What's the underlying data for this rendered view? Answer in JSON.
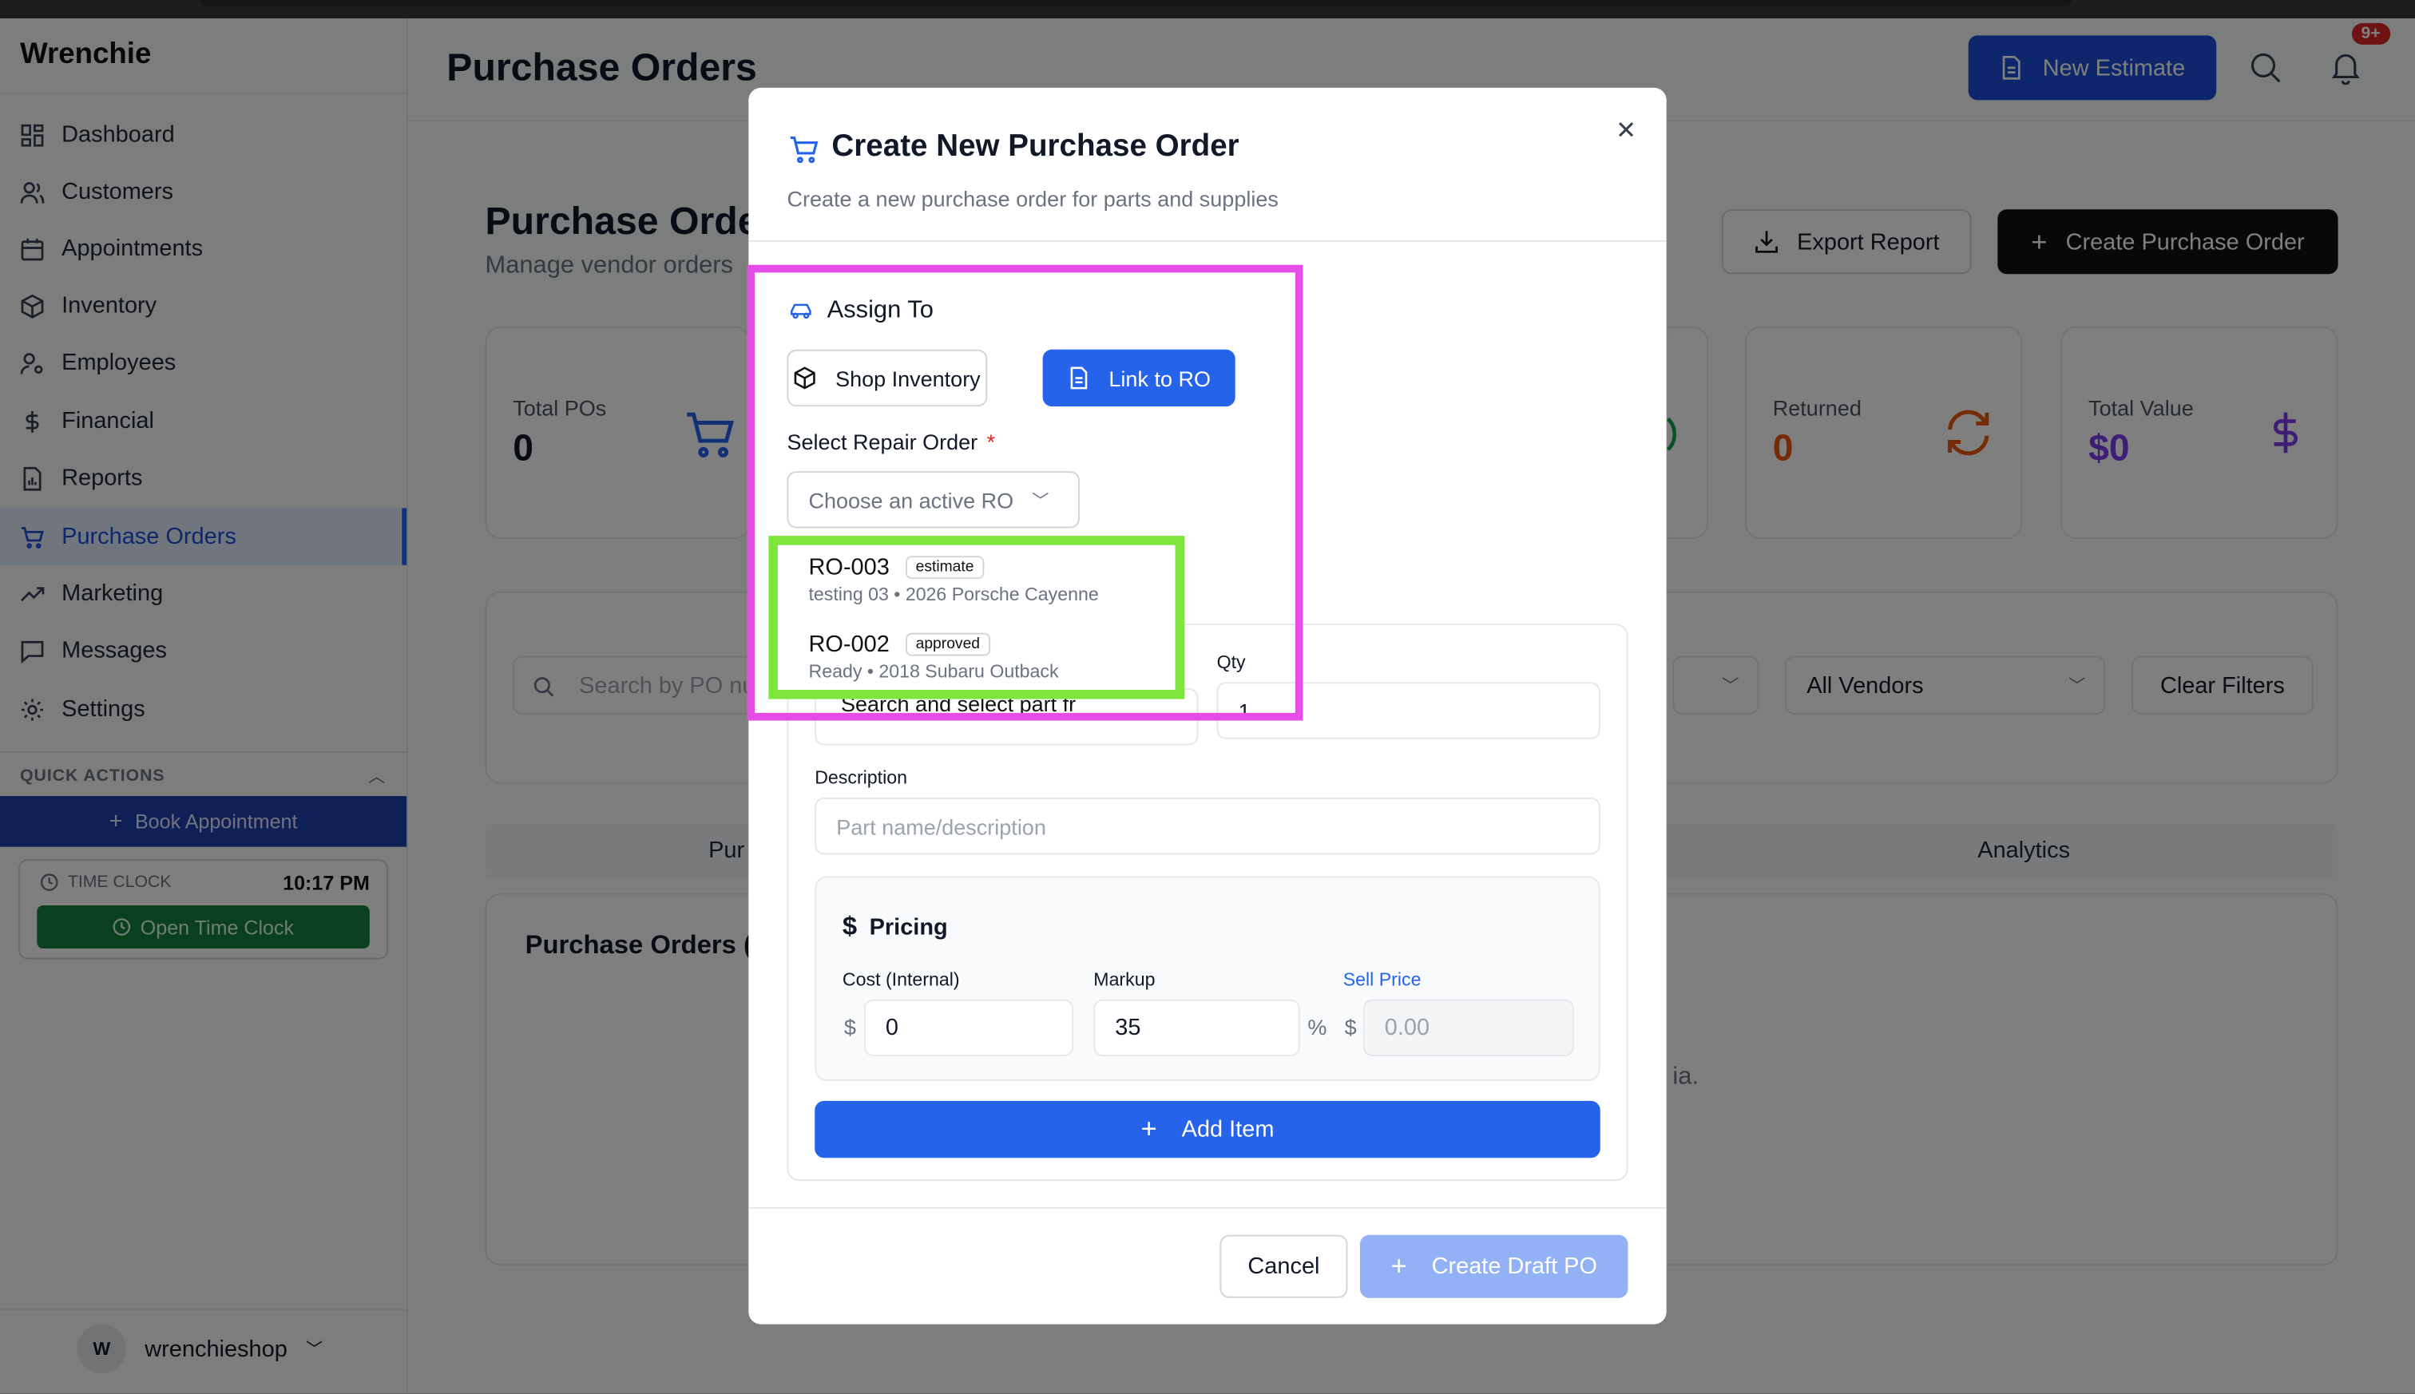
{
  "app": {
    "brand": "Wrenchie",
    "page_title": "Purchase Orders"
  },
  "sidebar": {
    "items": [
      {
        "label": "Dashboard",
        "icon": "grid-icon"
      },
      {
        "label": "Customers",
        "icon": "users-icon"
      },
      {
        "label": "Appointments",
        "icon": "calendar-icon"
      },
      {
        "label": "Inventory",
        "icon": "box-icon"
      },
      {
        "label": "Employees",
        "icon": "user-cog-icon"
      },
      {
        "label": "Financial",
        "icon": "dollar-icon"
      },
      {
        "label": "Reports",
        "icon": "report-icon"
      },
      {
        "label": "Purchase Orders",
        "icon": "cart-icon",
        "active": true
      },
      {
        "label": "Marketing",
        "icon": "trend-icon"
      },
      {
        "label": "Messages",
        "icon": "message-icon"
      },
      {
        "label": "Settings",
        "icon": "gear-icon"
      }
    ],
    "quick_actions": "QUICK ACTIONS",
    "book": "Book Appointment",
    "time_clock": {
      "label": "TIME CLOCK",
      "time": "10:17 PM",
      "button": "Open Time Clock"
    },
    "user": {
      "initial": "W",
      "name": "wrenchieshop"
    }
  },
  "header": {
    "new_estimate": "New Estimate",
    "notif_count": "9+"
  },
  "page": {
    "title": "Purchase Orders",
    "subtitle": "Manage vendor orders",
    "export": "Export Report",
    "create_po": "Create Purchase Order",
    "stats": [
      {
        "label": "Total POs",
        "value": "0"
      },
      {
        "label": "Returned",
        "value": "0"
      },
      {
        "label": "Total Value",
        "value": "$0"
      }
    ],
    "search_placeholder": "Search by PO nu",
    "vendor_filter": "All Vendors",
    "clear_filters": "Clear Filters",
    "tabs": {
      "first": "Pur",
      "analytics": "Analytics"
    },
    "po_card_title": "Purchase Orders (",
    "po_empty": "ia."
  },
  "modal": {
    "title": "Create New Purchase Order",
    "subtitle": "Create a new purchase order for parts and supplies",
    "assign_to": "Assign To",
    "shop_inventory": "Shop Inventory",
    "link_ro": "Link to RO",
    "select_ro_label": "Select Repair Order",
    "required": "*",
    "select_placeholder": "Choose an active RO",
    "ro_options": [
      {
        "id": "RO-003",
        "status": "estimate",
        "detail": "testing 03 • 2026 Porsche Cayenne"
      },
      {
        "id": "RO-002",
        "status": "approved",
        "detail": "Ready • 2018 Subaru Outback"
      }
    ],
    "qty_label": "Qty",
    "qty_value": "1",
    "part_placeholder": "Search and select part fr",
    "description_label": "Description",
    "description_placeholder": "Part name/description",
    "pricing": {
      "title": "Pricing",
      "cost_label": "Cost (Internal)",
      "markup_label": "Markup",
      "sell_label": "Sell Price",
      "currency": "$",
      "percent": "%",
      "cost_value": "0",
      "markup_value": "35",
      "sell_placeholder": "0.00"
    },
    "add_item": "Add Item",
    "cancel": "Cancel",
    "create_draft": "Create Draft PO"
  },
  "colors": {
    "primary": "#2563eb",
    "highlight_pink": "#e54ee6",
    "highlight_green": "#7ee53a",
    "success": "#16a34a",
    "orange": "#ea580c",
    "purple": "#7c3aed"
  }
}
